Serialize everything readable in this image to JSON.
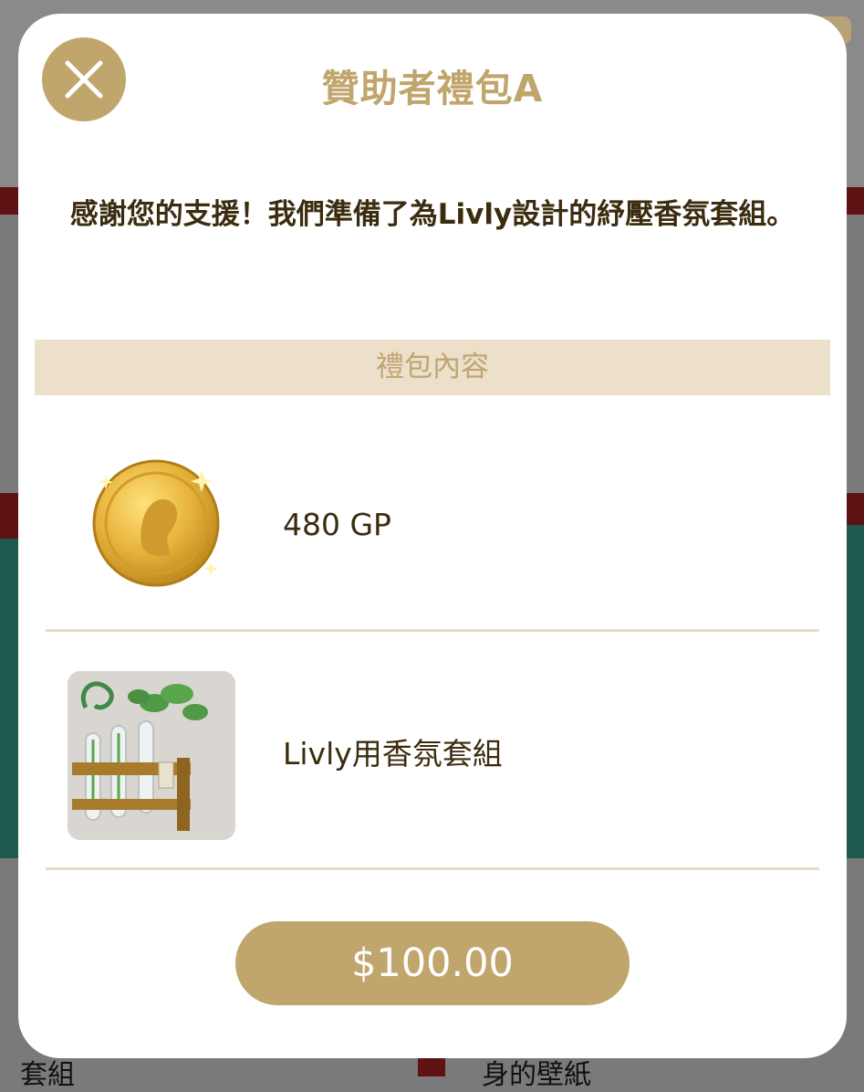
{
  "modal": {
    "title": "贊助者禮包A",
    "description": "感謝您的支援！我們準備了為Livly設計的紓壓香氛套組。",
    "section_header": "禮包內容",
    "items": [
      {
        "label": "480 GP",
        "icon": "gold-coin-icon"
      },
      {
        "label": "Livly用香氛套組",
        "icon": "aroma-kit-icon"
      }
    ],
    "price_label": "$100.00"
  },
  "background": {
    "left_text": "套組",
    "right_text": "身的壁紙"
  },
  "colors": {
    "accent": "#c0a66c",
    "text_dark": "#3b2c0f",
    "section_bg": "#ece0cb",
    "divider": "#e7dcc5"
  }
}
